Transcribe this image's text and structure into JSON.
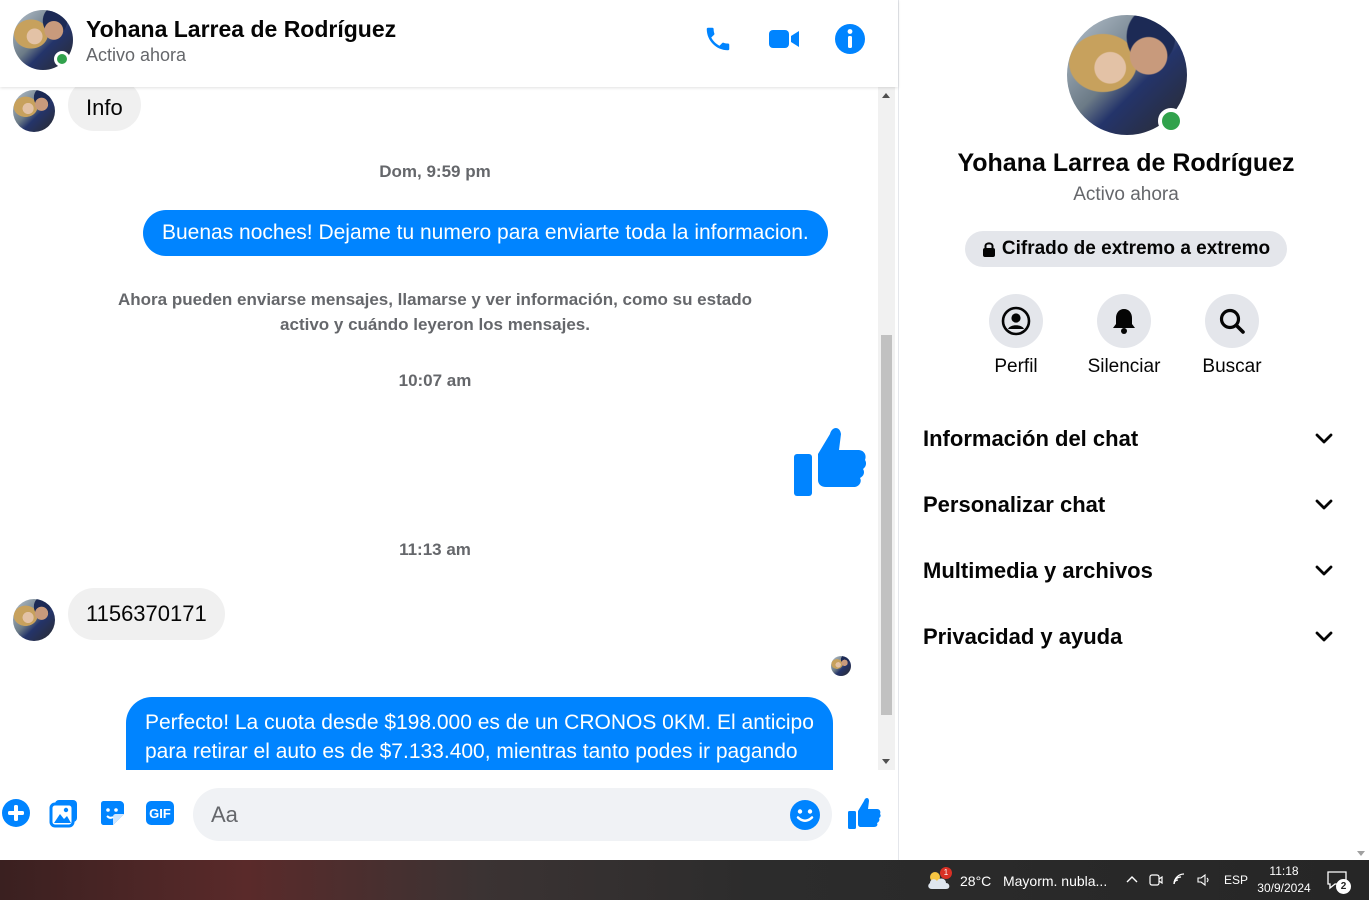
{
  "contact": {
    "name": "Yohana Larrea de Rodríguez",
    "status": "Activo ahora"
  },
  "header": {
    "icons": [
      "phone-icon",
      "video-call-icon",
      "info-icon"
    ]
  },
  "messages": {
    "m1": "Info",
    "t1": "Dom, 9:59 pm",
    "m2": "Buenas noches! Dejame tu numero para enviarte toda la informacion.",
    "system_note": "Ahora pueden enviarse mensajes, llamarse y ver información, como su estado activo y cuándo leyeron los mensajes.",
    "t2": "10:07 am",
    "t3": "11:13 am",
    "m3": "1156370171",
    "m4_line1": "Perfecto! La cuota desde $198.000 es de un CRONOS 0KM. El anticipo",
    "m4_line2": "para retirar el auto es de $7.133.400, mientras tanto podes ir pagando"
  },
  "composer": {
    "placeholder": "Aa",
    "icons": [
      "plus-icon",
      "photo-icon",
      "sticker-icon",
      "gif-icon",
      "emoji-icon",
      "thumbs-up-icon"
    ],
    "gif_label": "GIF"
  },
  "info_panel": {
    "name": "Yohana Larrea de Rodríguez",
    "status": "Activo ahora",
    "encryption_label": "Cifrado de extremo a extremo",
    "actions": [
      {
        "label": "Perfil",
        "icon": "profile-icon"
      },
      {
        "label": "Silenciar",
        "icon": "bell-icon"
      },
      {
        "label": "Buscar",
        "icon": "search-icon"
      }
    ],
    "sections": [
      {
        "label": "Información del chat"
      },
      {
        "label": "Personalizar chat"
      },
      {
        "label": "Multimedia y archivos"
      },
      {
        "label": "Privacidad y ayuda"
      }
    ]
  },
  "taskbar": {
    "weather_temp": "28°C",
    "weather_desc": "Mayorm. nubla...",
    "weather_alert": "1",
    "language": "ESP",
    "time": "11:18",
    "date": "30/9/2024",
    "notifications": "2"
  },
  "colors": {
    "accent": "#0084ff",
    "online": "#31a24c",
    "bubble_incoming": "#f0f0f0",
    "muted_text": "#65676b"
  }
}
